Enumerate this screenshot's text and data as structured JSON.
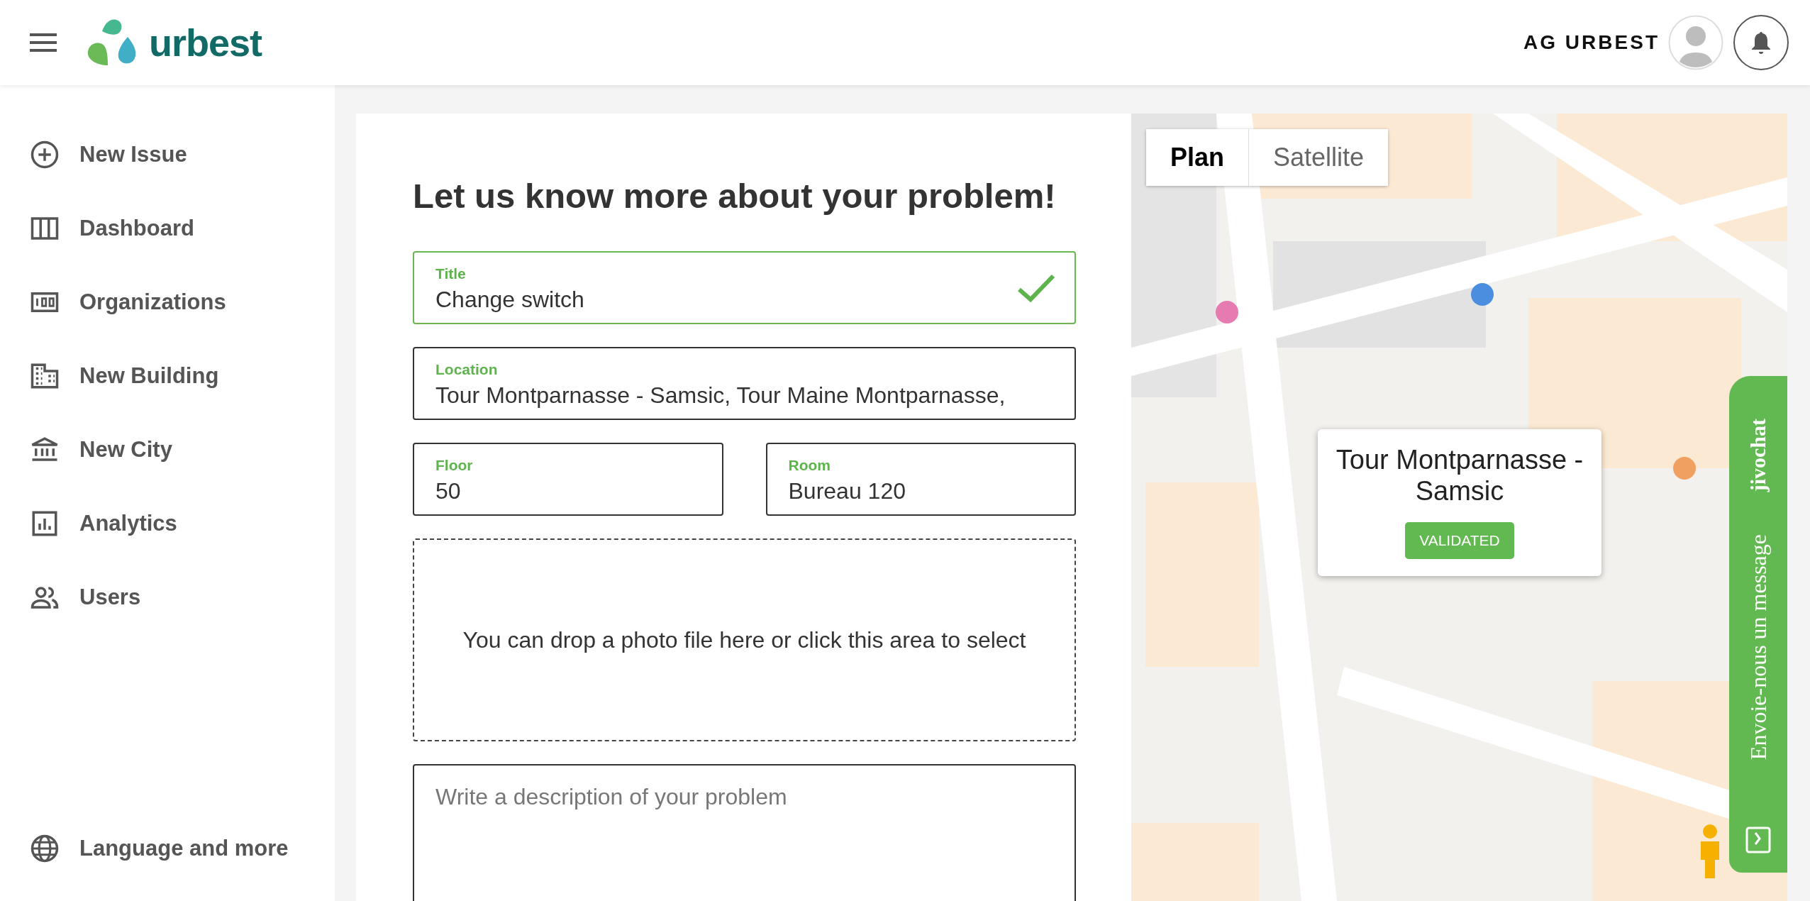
{
  "header": {
    "logo_text": "urbest",
    "user_name": "AG URBEST"
  },
  "sidebar": {
    "items": [
      {
        "kind": "plus",
        "label": "New Issue"
      },
      {
        "kind": "columns",
        "label": "Dashboard"
      },
      {
        "kind": "counter",
        "label": "Organizations"
      },
      {
        "kind": "building",
        "label": "New Building"
      },
      {
        "kind": "bank",
        "label": "New City"
      },
      {
        "kind": "chart",
        "label": "Analytics"
      },
      {
        "kind": "people",
        "label": "Users"
      }
    ],
    "footer_item": {
      "kind": "globe",
      "label": "Language and more"
    }
  },
  "form": {
    "heading": "Let us know more about your problem!",
    "fields": [
      {
        "label": "Title",
        "value": "Change switch",
        "valid": true
      },
      {
        "label": "Location",
        "value": "Tour Montparnasse - Samsic, Tour Maine Montparnasse,",
        "valid": false
      },
      {
        "label": "Floor",
        "value": "50",
        "valid": false
      },
      {
        "label": "Room",
        "value": "Bureau 120",
        "valid": false
      }
    ],
    "upload_text": "You can drop a photo file here or click this area to select",
    "description": {
      "placeholder": "Write a description of your problem"
    }
  },
  "map": {
    "type_buttons": [
      {
        "label": "Plan",
        "selected": true
      },
      {
        "label": "Satellite",
        "selected": false
      }
    ],
    "info_window": {
      "title": "Tour Montparnasse - Samsic",
      "status": "VALIDATED"
    }
  },
  "chat": {
    "brand": "jivochat",
    "prompt": "Envoie-nous un message"
  }
}
